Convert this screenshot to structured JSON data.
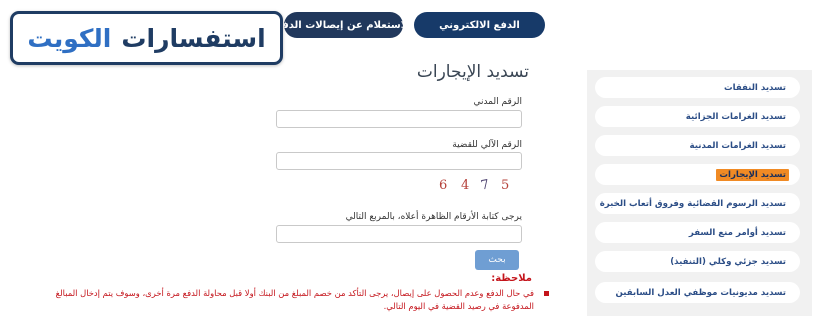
{
  "header": {
    "tabs": [
      {
        "label": "الدفع الالكتروني"
      },
      {
        "label": "الاستعلام عن إيصالات الدفع"
      }
    ]
  },
  "brand": {
    "word1": "استفسارات",
    "word2": "الكويت"
  },
  "form": {
    "title": "تسديد الإيجارات",
    "civil_id_label": "الرقم المدني",
    "civil_id_value": "",
    "case_number_label": "الرقم الآلي للقضية",
    "case_number_value": "",
    "captcha_digits": [
      "6",
      "4",
      "7",
      "5"
    ],
    "captcha_label": "يرجى كتابة الأرقام الظاهرة أعلاه، بالمربع التالي",
    "captcha_value": "",
    "submit_label": "بحث"
  },
  "notes": {
    "title": "ملاحظة:",
    "text": "في حال الدفع وعدم الحصول على إيصال، يرجى التأكد من خصم المبلغ من البنك أولا قبل محاولة الدفع مرة أخرى، وسوف يتم إدخال المبالغ المدفوعة في رصيد القضية في اليوم التالي."
  },
  "sidebar": {
    "items": [
      {
        "label": "تسديد النفقات"
      },
      {
        "label": "تسديد الغرامات الجزائية"
      },
      {
        "label": "تسديد الغرامات المدنية"
      },
      {
        "label": "تسديد الإيجارات"
      },
      {
        "label": "تسديد الرسوم القضائية وفروق أتعاب الخبرة"
      },
      {
        "label": "تسديد أوامر منع السفر"
      },
      {
        "label": "تسديد جزئي وكلي (التنفيذ)"
      },
      {
        "label": "تسديد مديونيات موظفي العدل السابقين"
      }
    ]
  },
  "colors": {
    "navy": "#1f3c63",
    "brand_blue": "#2f6fc3",
    "active": "#f08a24",
    "note_red": "#c4141b",
    "button": "#6f9ed3"
  }
}
